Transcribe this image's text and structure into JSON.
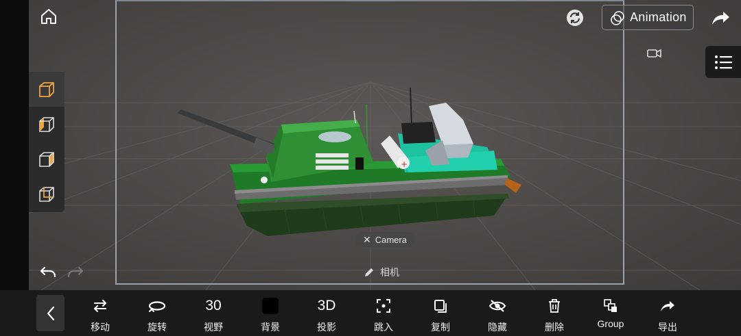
{
  "top_bar": {
    "home_icon": "home-icon",
    "animation_label": "Animation",
    "refresh_icon": "refresh-icon",
    "share_icon": "share-icon"
  },
  "left_panel": {
    "views": [
      {
        "name": "view-cube-front",
        "active": true
      },
      {
        "name": "view-cube-left",
        "active": false
      },
      {
        "name": "view-cube-right",
        "active": false
      },
      {
        "name": "view-cube-back",
        "active": false
      }
    ],
    "undo_icon": "undo-icon",
    "redo_icon": "redo-icon"
  },
  "viewport": {
    "camera_chip_label": "Camera",
    "camera_name": "相机",
    "camera_icon": "video-camera-icon",
    "list_icon": "list-icon",
    "accent_color": "#f0a53c"
  },
  "toolbar": {
    "back_icon": "chevron-left-icon",
    "tools": [
      {
        "key": "move",
        "label": "移动",
        "icon": "move-arrows-icon"
      },
      {
        "key": "rotate",
        "label": "旋转",
        "icon": "rotate-icon"
      },
      {
        "key": "fov",
        "label": "视野",
        "value": "30"
      },
      {
        "key": "background",
        "label": "背景",
        "icon": "black-square-icon"
      },
      {
        "key": "projection",
        "label": "投影",
        "value": "3D"
      },
      {
        "key": "jump_in",
        "label": "跳入",
        "icon": "focus-icon"
      },
      {
        "key": "copy",
        "label": "复制",
        "icon": "copy-icon"
      },
      {
        "key": "hide",
        "label": "隐藏",
        "icon": "eye-off-icon"
      },
      {
        "key": "delete",
        "label": "删除",
        "icon": "trash-icon"
      },
      {
        "key": "group",
        "label": "Group",
        "icon": "group-icon"
      },
      {
        "key": "export",
        "label": "导出",
        "icon": "export-icon"
      }
    ]
  }
}
